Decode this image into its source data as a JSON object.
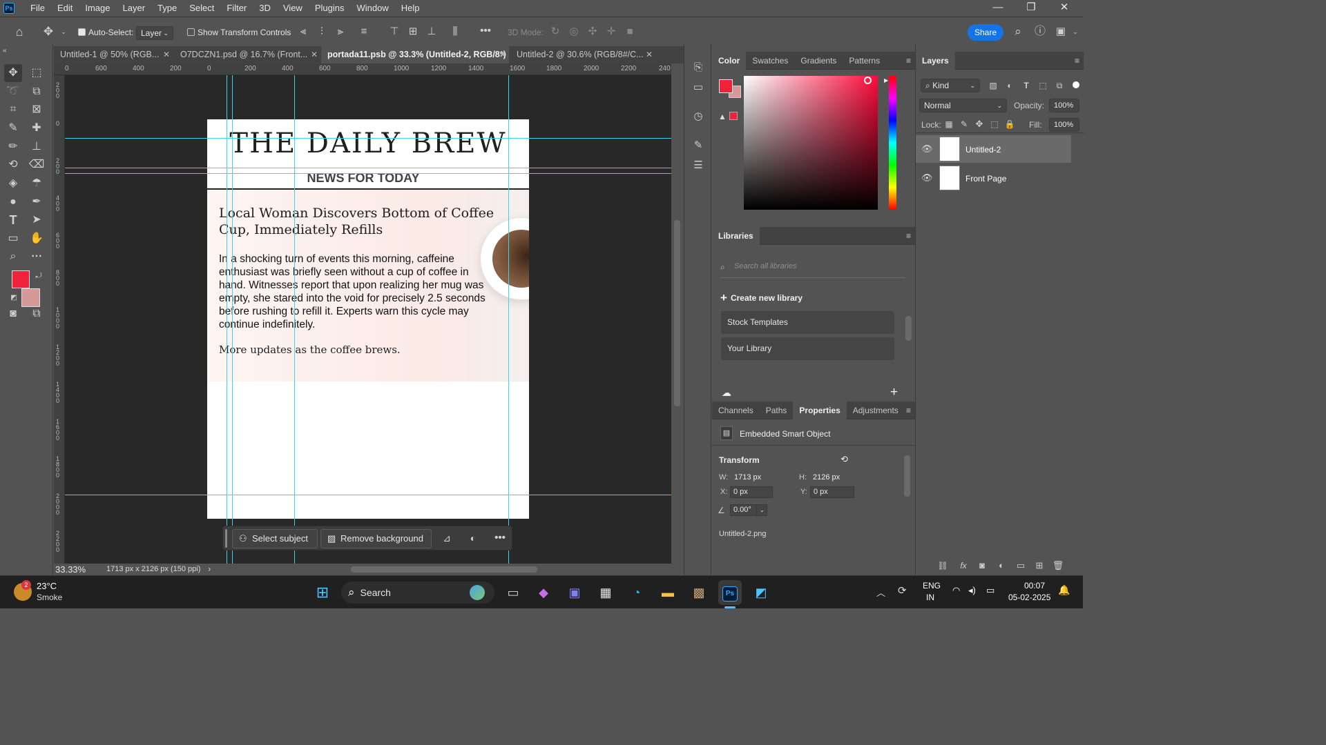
{
  "app": {
    "logo": "Ps"
  },
  "menubar": {
    "items": [
      "File",
      "Edit",
      "Image",
      "Layer",
      "Type",
      "Select",
      "Filter",
      "3D",
      "View",
      "Plugins",
      "Window",
      "Help"
    ],
    "minimize": "—",
    "restore": "❐",
    "close": "✕"
  },
  "optionsbar": {
    "auto_select_label": "Auto-Select:",
    "auto_select_checked": true,
    "auto_select_target": "Layer",
    "show_transform_label": "Show Transform Controls",
    "show_transform_checked": false,
    "more": "•••",
    "mode_3d_label": "3D Mode:",
    "share_label": "Share"
  },
  "tabs": [
    {
      "label": "Untitled-1 @ 50% (RGB...",
      "active": false
    },
    {
      "label": "O7DCZN1.psd @ 16.7% (Front...",
      "active": false
    },
    {
      "label": "portada11.psb @ 33.3% (Untitled-2, RGB/8*)",
      "active": true
    },
    {
      "label": "Untitled-2 @ 30.6% (RGB/8#/C...",
      "active": false
    }
  ],
  "ruler": {
    "h_labels": [
      "0",
      "600",
      "400",
      "200",
      "0",
      "200",
      "400",
      "600",
      "800",
      "1000",
      "1200",
      "1400",
      "1600",
      "1800",
      "2000",
      "2200",
      "240"
    ],
    "v_labels": [
      "200",
      "0",
      "200",
      "400",
      "600",
      "800",
      "1000",
      "1200",
      "1400",
      "1600",
      "1800",
      "2000",
      "2200"
    ]
  },
  "document": {
    "masthead": "THE DAILY BREW",
    "subhead": "NEWS FOR TODAY",
    "headline": "Local Woman Discovers Bottom of Coffee Cup, Immediately Refills",
    "body": "In a shocking turn of events this morning, caffeine enthusiast was briefly seen without a cup of coffee in hand. Witnesses report that upon realizing her mug was empty, she stared into the void for precisely 2.5 seconds before rushing to refill it. Experts warn this cycle may continue indefinitely.",
    "footer": "More updates as the coffee brews."
  },
  "contextbar": {
    "select_subject": "Select subject",
    "remove_background": "Remove background",
    "more": "•••"
  },
  "status": {
    "zoom": "33.33%",
    "doc_info": "1713 px x 2126 px (150 ppi)",
    "arrow": "›"
  },
  "color_panel": {
    "tabs": [
      "Color",
      "Swatches",
      "Gradients",
      "Patterns"
    ],
    "active_tab": "Color",
    "foreground": "#f0213a",
    "background": "#d49a9a"
  },
  "libraries": {
    "title": "Libraries",
    "search_placeholder": "Search all libraries",
    "create_label": "Create new library",
    "items": [
      "Stock Templates",
      "Your Library"
    ]
  },
  "properties": {
    "tabs": [
      "Channels",
      "Paths",
      "Properties",
      "Adjustments"
    ],
    "active_tab": "Properties",
    "type_label": "Embedded Smart Object",
    "transform_label": "Transform",
    "w_label": "W:",
    "w_value": "1713 px",
    "h_label": "H:",
    "h_value": "2126 px",
    "x_label": "X:",
    "x_value": "0 px",
    "y_label": "Y:",
    "y_value": "0 px",
    "angle_value": "0.00°",
    "filename": "Untitled-2.png"
  },
  "layers": {
    "title": "Layers",
    "filter_kind": "Kind",
    "blend_mode": "Normal",
    "opacity_label": "Opacity:",
    "opacity_value": "100%",
    "lock_label": "Lock:",
    "fill_label": "Fill:",
    "fill_value": "100%",
    "items": [
      {
        "name": "Untitled-2",
        "selected": true
      },
      {
        "name": "Front Page",
        "selected": false
      }
    ]
  },
  "taskbar": {
    "weather_temp": "23°C",
    "weather_desc": "Smoke",
    "weather_badge": "2",
    "search_label": "Search",
    "lang_1": "ENG",
    "lang_2": "IN",
    "time": "00:07",
    "date": "05-02-2025"
  },
  "colors": {
    "accent_blue": "#1473e6",
    "guide_cyan": "#38d6e8"
  }
}
